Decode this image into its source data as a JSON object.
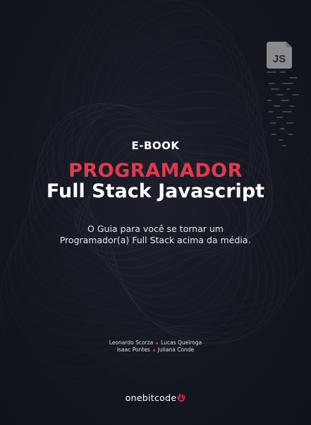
{
  "cover": {
    "label": "E-BOOK",
    "title_line1": "PROGRAMADOR",
    "title_line2": "Full Stack Javascript",
    "subtitle_line1": "O Guia para você se tornar um",
    "subtitle_line2": "Programador(a) Full Stack acima da média",
    "subtitle_dot": ".",
    "js_icon_label": "JS"
  },
  "authors": {
    "row1": [
      "Leonardo Scorza",
      "Lucas Queiroga"
    ],
    "row2": [
      "Isaac Pontes",
      "Juliana Conde"
    ]
  },
  "brand": {
    "name": "onebitcode"
  },
  "colors": {
    "background": "#14161f",
    "accent": "#e03a50",
    "text": "#ffffff",
    "icon": "#8a8a8f"
  },
  "icons": [
    "javascript-file-icon",
    "onebitcode-logo-icon"
  ]
}
